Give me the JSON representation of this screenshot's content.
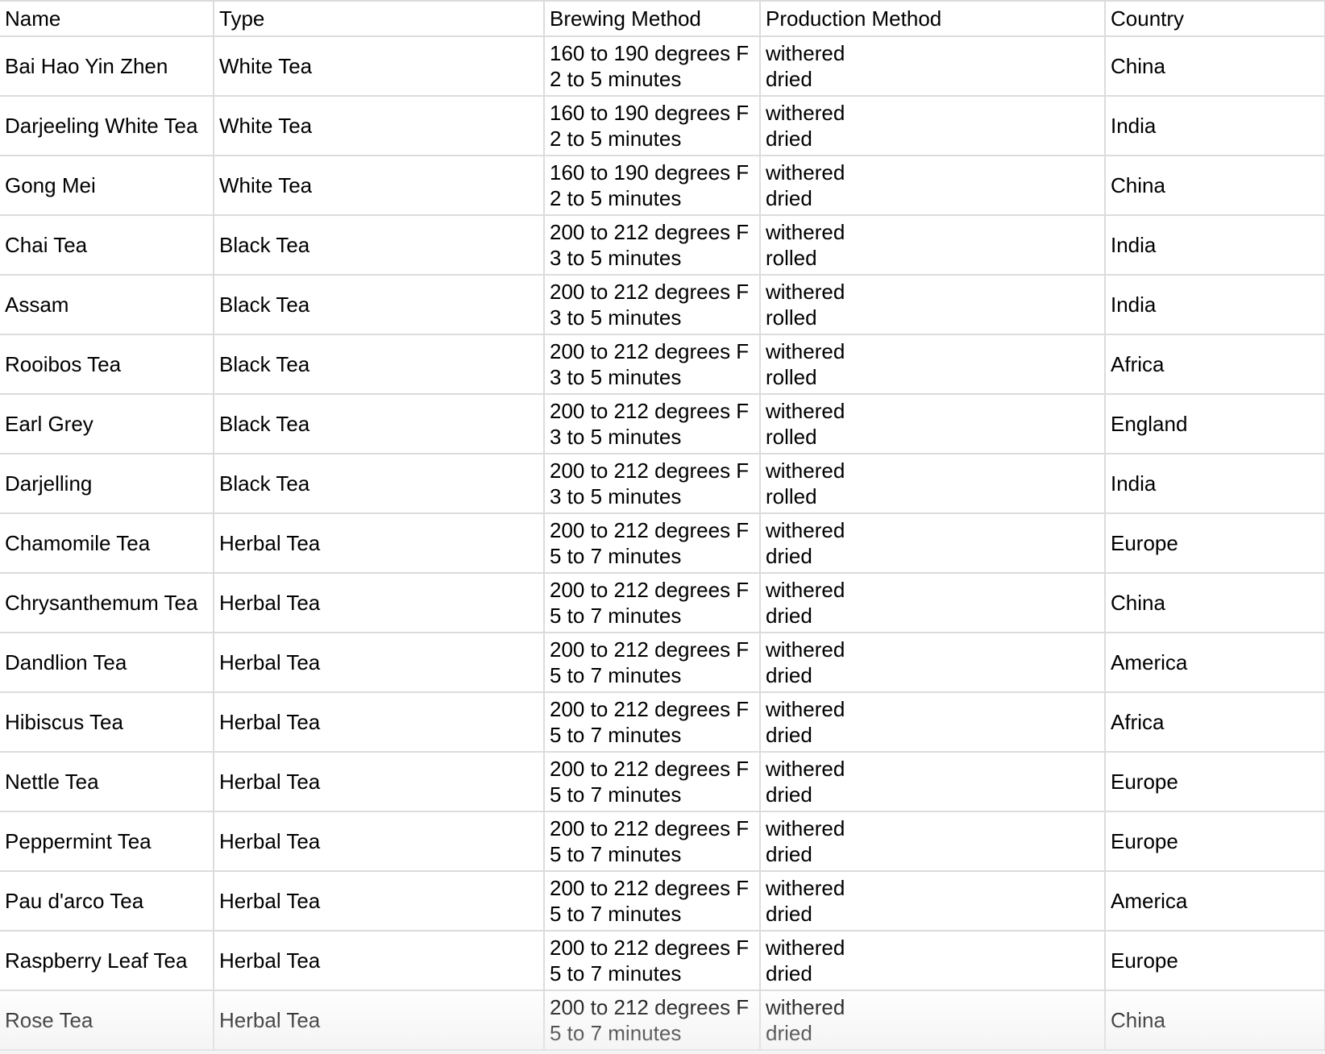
{
  "columns": {
    "name": "Name",
    "type": "Type",
    "brewing": "Brewing Method",
    "production": "Production Method",
    "country": "Country"
  },
  "rows": [
    {
      "name": "Bai Hao Yin Zhen",
      "type": "White Tea",
      "brew_temp": "160 to 190 degrees F",
      "brew_time": "2 to 5 minutes",
      "prod_1": "withered",
      "prod_2": "dried",
      "country": "China"
    },
    {
      "name": "Darjeeling White Tea",
      "type": "White Tea",
      "brew_temp": "160 to 190 degrees F",
      "brew_time": "2 to 5 minutes",
      "prod_1": "withered",
      "prod_2": "dried",
      "country": "India"
    },
    {
      "name": "Gong Mei",
      "type": "White Tea",
      "brew_temp": "160 to 190 degrees F",
      "brew_time": "2 to 5 minutes",
      "prod_1": "withered",
      "prod_2": "dried",
      "country": "China"
    },
    {
      "name": "Chai Tea",
      "type": "Black Tea",
      "brew_temp": "200 to 212 degrees F",
      "brew_time": "3 to 5 minutes",
      "prod_1": "withered",
      "prod_2": "rolled",
      "country": "India"
    },
    {
      "name": "Assam",
      "type": "Black Tea",
      "brew_temp": "200 to 212 degrees F",
      "brew_time": "3 to 5 minutes",
      "prod_1": "withered",
      "prod_2": "rolled",
      "country": "India"
    },
    {
      "name": "Rooibos Tea",
      "type": "Black Tea",
      "brew_temp": "200 to 212 degrees F",
      "brew_time": "3 to 5 minutes",
      "prod_1": "withered",
      "prod_2": "rolled",
      "country": "Africa"
    },
    {
      "name": "Earl Grey",
      "type": "Black Tea",
      "brew_temp": "200 to 212 degrees F",
      "brew_time": "3 to 5 minutes",
      "prod_1": "withered",
      "prod_2": "rolled",
      "country": "England"
    },
    {
      "name": "Darjelling",
      "type": "Black Tea",
      "brew_temp": "200 to 212 degrees F",
      "brew_time": "3 to 5 minutes",
      "prod_1": "withered",
      "prod_2": "rolled",
      "country": "India"
    },
    {
      "name": "Chamomile Tea",
      "type": "Herbal Tea",
      "brew_temp": "200 to 212 degrees F",
      "brew_time": "5 to 7 minutes",
      "prod_1": "withered",
      "prod_2": "dried",
      "country": "Europe"
    },
    {
      "name": "Chrysanthemum Tea",
      "type": "Herbal Tea",
      "brew_temp": "200 to 212 degrees F",
      "brew_time": "5 to 7 minutes",
      "prod_1": "withered",
      "prod_2": "dried",
      "country": "China"
    },
    {
      "name": "Dandlion Tea",
      "type": "Herbal Tea",
      "brew_temp": "200 to 212 degrees F",
      "brew_time": "5 to 7 minutes",
      "prod_1": "withered",
      "prod_2": "dried",
      "country": "America"
    },
    {
      "name": "Hibiscus Tea",
      "type": "Herbal Tea",
      "brew_temp": "200 to 212 degrees F",
      "brew_time": "5 to 7 minutes",
      "prod_1": "withered",
      "prod_2": "dried",
      "country": "Africa"
    },
    {
      "name": "Nettle Tea",
      "type": "Herbal Tea",
      "brew_temp": "200 to 212 degrees F",
      "brew_time": "5 to 7 minutes",
      "prod_1": "withered",
      "prod_2": "dried",
      "country": "Europe"
    },
    {
      "name": "Peppermint Tea",
      "type": "Herbal Tea",
      "brew_temp": "200 to 212 degrees F",
      "brew_time": "5 to 7 minutes",
      "prod_1": "withered",
      "prod_2": "dried",
      "country": "Europe"
    },
    {
      "name": "Pau d'arco Tea",
      "type": "Herbal Tea",
      "brew_temp": "200 to 212 degrees F",
      "brew_time": "5 to 7 minutes",
      "prod_1": "withered",
      "prod_2": "dried",
      "country": "America"
    },
    {
      "name": "Raspberry Leaf Tea",
      "type": "Herbal Tea",
      "brew_temp": "200 to 212 degrees F",
      "brew_time": "5 to 7 minutes",
      "prod_1": "withered",
      "prod_2": "dried",
      "country": "Europe"
    },
    {
      "name": "Rose Tea",
      "type": "Herbal Tea",
      "brew_temp": "200 to 212 degrees F",
      "brew_time": "5 to 7 minutes",
      "prod_1": "withered",
      "prod_2": "dried",
      "country": "China"
    }
  ]
}
